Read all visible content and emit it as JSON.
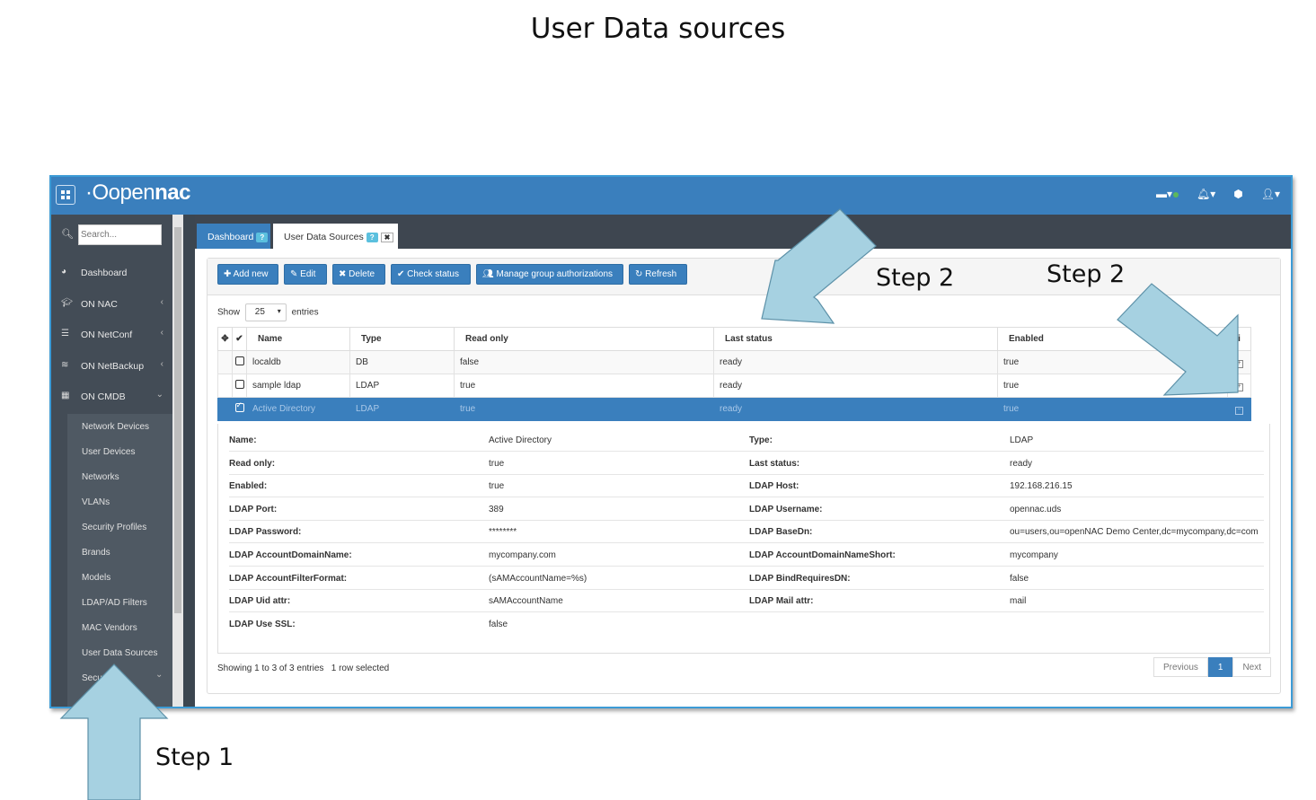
{
  "slide": {
    "title": "User Data sources",
    "steps": [
      "Step 2",
      "Step 2",
      "Step 1"
    ]
  },
  "app": {
    "logo_prefix": "·O",
    "logo_light": "open",
    "logo_bold": "nac",
    "top_icons": [
      "monitor-icon",
      "bell-icon",
      "cube-icon",
      "user-icon"
    ]
  },
  "sidebar": {
    "search_placeholder": "Search...",
    "items": [
      {
        "label": "Dashboard",
        "icon": "dashboard-icon",
        "has_chevron": false
      },
      {
        "label": "ON NAC",
        "icon": "graduation-cap-icon",
        "has_chevron": true
      },
      {
        "label": "ON NetConf",
        "icon": "server-icon",
        "has_chevron": true
      },
      {
        "label": "ON NetBackup",
        "icon": "database-icon",
        "has_chevron": true
      },
      {
        "label": "ON CMDB",
        "icon": "grid-icon",
        "has_chevron": true
      }
    ],
    "sub_items": [
      "Network Devices",
      "User Devices",
      "Networks",
      "VLANs",
      "Security Profiles",
      "Brands",
      "Models",
      "LDAP/AD Filters",
      "MAC Vendors",
      "User Data Sources",
      "Secu"
    ]
  },
  "tabs": {
    "dashboard": "Dashboard",
    "current": "User Data Sources",
    "help": "?",
    "close": "✖"
  },
  "toolbar": {
    "add": "Add new",
    "edit": "Edit",
    "delete": "Delete",
    "check": "Check status",
    "manage": "Manage group authorizations",
    "refresh": "Refresh"
  },
  "table": {
    "show_label": "Show",
    "page_size": "25",
    "entries_label": "entries",
    "columns": [
      "Name",
      "Type",
      "Read only",
      "Last status",
      "Enabled"
    ],
    "info_col": "i",
    "rows": [
      {
        "name": "localdb",
        "type": "DB",
        "read_only": "false",
        "last_status": "ready",
        "enabled": "true",
        "selected": false
      },
      {
        "name": "sample ldap",
        "type": "LDAP",
        "read_only": "true",
        "last_status": "ready",
        "enabled": "true",
        "selected": false
      },
      {
        "name": "Active Directory",
        "type": "LDAP",
        "read_only": "true",
        "last_status": "ready",
        "enabled": "true",
        "selected": true
      }
    ]
  },
  "detail": [
    [
      "Name:",
      "Active Directory",
      "Type:",
      "LDAP"
    ],
    [
      "Read only:",
      "true",
      "Last status:",
      "ready"
    ],
    [
      "Enabled:",
      "true",
      "LDAP Host:",
      "192.168.216.15"
    ],
    [
      "LDAP Port:",
      "389",
      "LDAP Username:",
      "opennac.uds"
    ],
    [
      "LDAP Password:",
      "********",
      "LDAP BaseDn:",
      "ou=users,ou=openNAC Demo Center,dc=mycompany,dc=com"
    ],
    [
      "LDAP AccountDomainName:",
      "mycompany.com",
      "LDAP AccountDomainNameShort:",
      "mycompany"
    ],
    [
      "LDAP AccountFilterFormat:",
      "(sAMAccountName=%s)",
      "LDAP BindRequiresDN:",
      "false"
    ],
    [
      "LDAP Uid attr:",
      "sAMAccountName",
      "LDAP Mail attr:",
      "mail"
    ],
    [
      "LDAP Use SSL:",
      "false",
      "",
      ""
    ]
  ],
  "footer": {
    "info": "Showing 1 to 3 of 3 entries",
    "selected": "1 row selected",
    "prev": "Previous",
    "page": "1",
    "next": "Next"
  }
}
